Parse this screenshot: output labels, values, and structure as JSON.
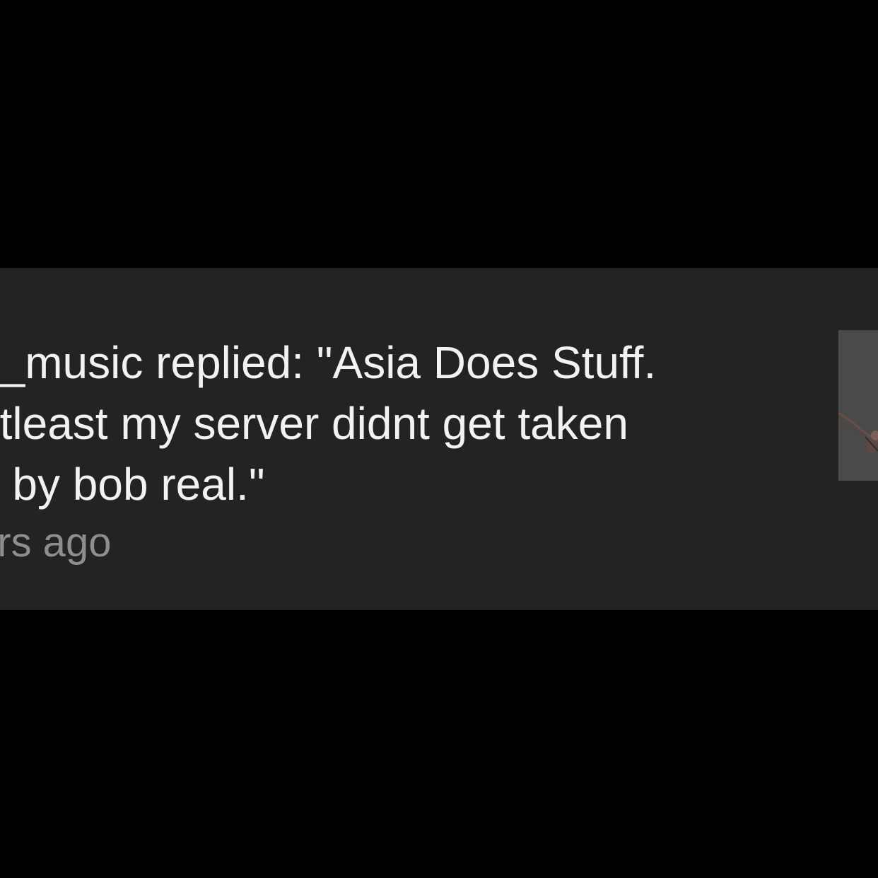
{
  "notification": {
    "lines": [
      "n_music replied: \"Asia Does Stuff.",
      "atleast my server didnt get taken",
      "n by bob real.\""
    ],
    "time": "urs ago"
  },
  "colors": {
    "background": "#000000",
    "card": "#232323",
    "text": "#f2f2f2",
    "muted": "#8e8e8e",
    "thumbnail": "#4a4a4a"
  },
  "thumbnail": {
    "icon": "post-thumbnail-image"
  }
}
